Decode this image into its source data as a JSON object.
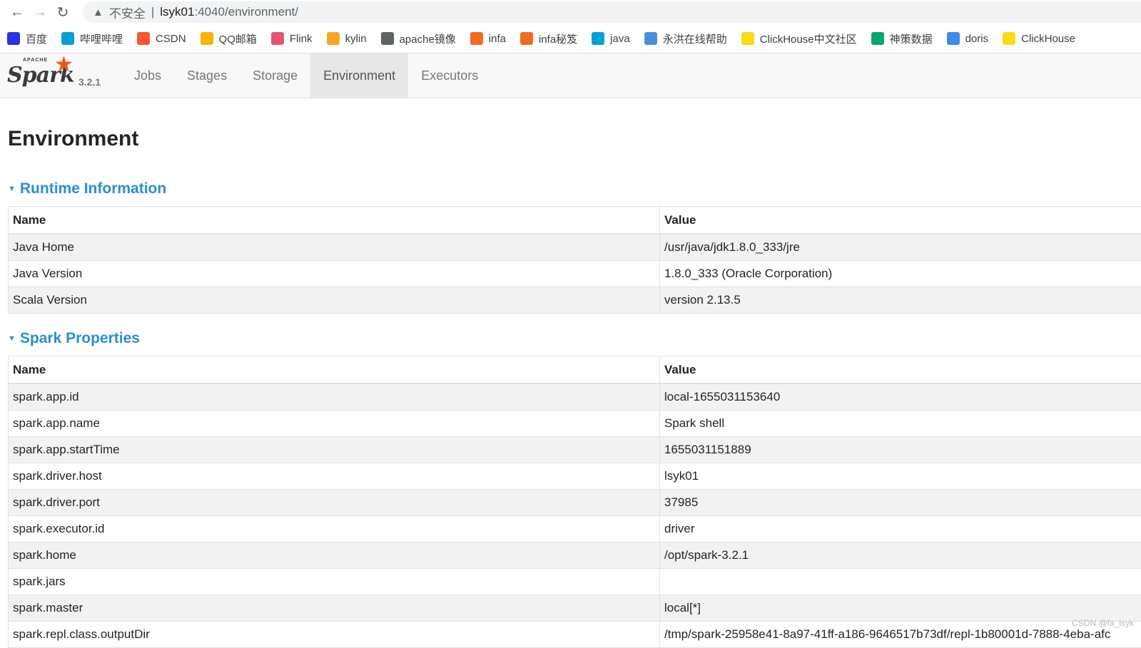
{
  "browser": {
    "insecure_label": "不安全",
    "url_host": "lsyk01",
    "url_path": ":4040/environment/",
    "bookmarks": [
      {
        "label": "百度",
        "icon": "baidu-icon",
        "color": "#2932e1"
      },
      {
        "label": "哔哩哔哩",
        "icon": "bilibili-icon",
        "color": "#00a1d6"
      },
      {
        "label": "CSDN",
        "icon": "csdn-icon",
        "color": "#fc5531"
      },
      {
        "label": "QQ邮箱",
        "icon": "qqmail-icon",
        "color": "#f4b400"
      },
      {
        "label": "Flink",
        "icon": "flink-icon",
        "color": "#e6526f"
      },
      {
        "label": "kylin",
        "icon": "kylin-icon",
        "color": "#f7a823"
      },
      {
        "label": "apache镜像",
        "icon": "globe-icon",
        "color": "#5f6368"
      },
      {
        "label": "infa",
        "icon": "infa-icon",
        "color": "#f26b21"
      },
      {
        "label": "infa秘笈",
        "icon": "infa-icon",
        "color": "#f26b21"
      },
      {
        "label": "java",
        "icon": "bilibili-icon",
        "color": "#00a1d6"
      },
      {
        "label": "永洪在线帮助",
        "icon": "yonghong-icon",
        "color": "#4a90d9"
      },
      {
        "label": "ClickHouse中文社区",
        "icon": "clickhouse-icon",
        "color": "#fadb14"
      },
      {
        "label": "神策数据",
        "icon": "sensors-icon",
        "color": "#00a870"
      },
      {
        "label": "doris",
        "icon": "doris-icon",
        "color": "#3c8ce7"
      },
      {
        "label": "ClickHouse",
        "icon": "clickhouse-icon",
        "color": "#fadb14"
      }
    ]
  },
  "spark": {
    "version": "3.2.1",
    "tabs": [
      "Jobs",
      "Stages",
      "Storage",
      "Environment",
      "Executors"
    ],
    "active_tab": "Environment"
  },
  "page": {
    "title": "Environment",
    "runtime": {
      "heading": "Runtime Information",
      "headers": [
        "Name",
        "Value"
      ],
      "rows": [
        [
          "Java Home",
          "/usr/java/jdk1.8.0_333/jre"
        ],
        [
          "Java Version",
          "1.8.0_333 (Oracle Corporation)"
        ],
        [
          "Scala Version",
          "version 2.13.5"
        ]
      ]
    },
    "spark_props": {
      "heading": "Spark Properties",
      "headers": [
        "Name",
        "Value"
      ],
      "rows": [
        [
          "spark.app.id",
          "local-1655031153640"
        ],
        [
          "spark.app.name",
          "Spark shell"
        ],
        [
          "spark.app.startTime",
          "1655031151889"
        ],
        [
          "spark.driver.host",
          "lsyk01"
        ],
        [
          "spark.driver.port",
          "37985"
        ],
        [
          "spark.executor.id",
          "driver"
        ],
        [
          "spark.home",
          "/opt/spark-3.2.1"
        ],
        [
          "spark.jars",
          ""
        ],
        [
          "spark.master",
          "local[*]"
        ],
        [
          "spark.repl.class.outputDir",
          "/tmp/spark-25958e41-8a97-41ff-a186-9646517b73df/repl-1b80001d-7888-4eba-afc"
        ]
      ]
    }
  },
  "watermark": "CSDN @fa_lsyk"
}
